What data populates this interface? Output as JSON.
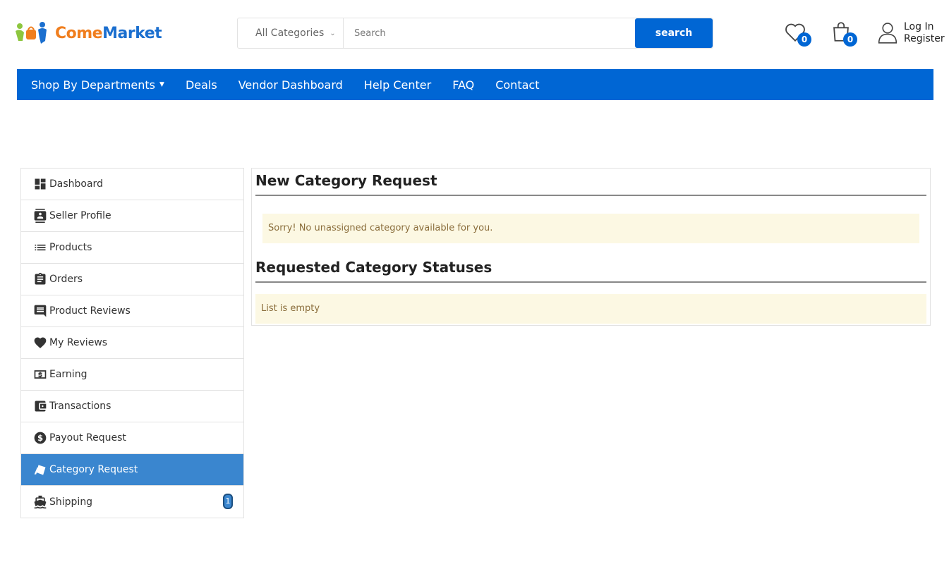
{
  "brand": {
    "part1": "Come",
    "part2": "Market",
    "accent": "#0066d4",
    "orange": "#f07e1e"
  },
  "search": {
    "category": "All Categories",
    "placeholder": "Search",
    "button": "search"
  },
  "header": {
    "wishlist_count": "0",
    "cart_count": "0",
    "login": "Log In",
    "register": "Register"
  },
  "nav": {
    "items": [
      {
        "label": "Shop By Departments"
      },
      {
        "label": "Deals"
      },
      {
        "label": "Vendor Dashboard"
      },
      {
        "label": "Help Center"
      },
      {
        "label": "FAQ"
      },
      {
        "label": "Contact"
      }
    ]
  },
  "sidebar": {
    "items": [
      {
        "label": "Dashboard",
        "icon": "dashboard-icon"
      },
      {
        "label": "Seller Profile",
        "icon": "contact-card-icon"
      },
      {
        "label": "Products",
        "icon": "list-icon"
      },
      {
        "label": "Orders",
        "icon": "clipboard-icon"
      },
      {
        "label": "Product Reviews",
        "icon": "comment-icon"
      },
      {
        "label": "My Reviews",
        "icon": "heart-icon"
      },
      {
        "label": "Earning",
        "icon": "money-icon"
      },
      {
        "label": "Transactions",
        "icon": "wallet-icon"
      },
      {
        "label": "Payout Request",
        "icon": "dollar-icon"
      },
      {
        "label": "Category Request",
        "icon": "category-icon",
        "active": true
      },
      {
        "label": "Shipping",
        "icon": "ship-icon",
        "badge": "1"
      }
    ]
  },
  "main": {
    "new_title": "New Category Request",
    "new_alert": "Sorry! No unassigned category available for you.",
    "status_title": "Requested Category Statuses",
    "status_alert": "List is empty"
  }
}
